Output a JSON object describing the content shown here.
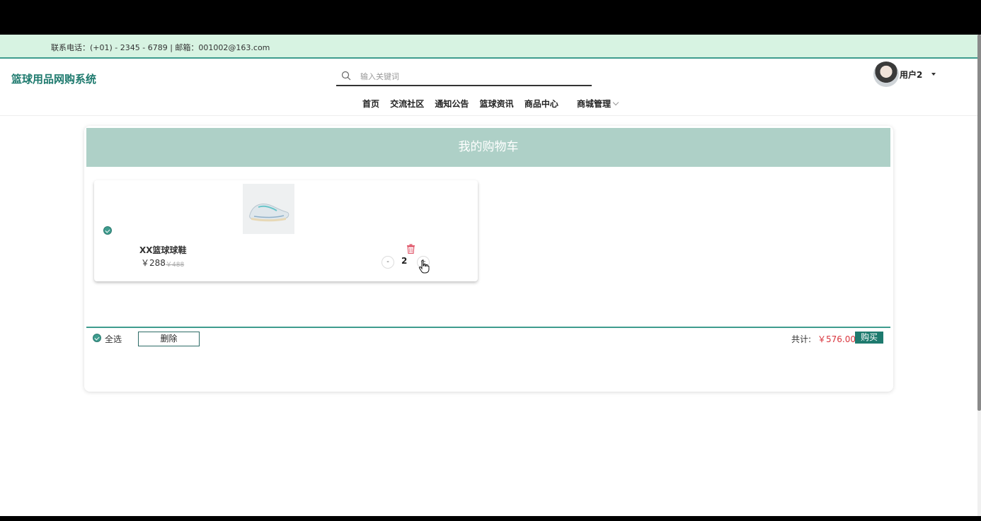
{
  "topbar": {
    "contact": "联系电话：(+01) - 2345 - 6789 | 邮箱：001002@163.com"
  },
  "header": {
    "logo": "篮球用品网购系统",
    "search_placeholder": "输入关键词",
    "user_name": "用户2"
  },
  "nav": {
    "items": [
      "首页",
      "交流社区",
      "通知公告",
      "篮球资讯",
      "商品中心",
      "商城管理"
    ]
  },
  "cart": {
    "title": "我的购物车",
    "item": {
      "name": "XX篮球球鞋",
      "price": "￥288",
      "old_price": "￥488",
      "quantity": "2",
      "minus": "-",
      "plus": "+"
    },
    "select_all": "全选",
    "delete_label": "删除",
    "total_label": "共计:",
    "total_value": "￥576.00",
    "buy_label": "购买"
  },
  "colors": {
    "accent": "#1e7a6e",
    "title_bg": "#aed0c7",
    "topbar_bg": "#d7f3e2",
    "total": "#d9363e"
  },
  "icons": [
    "search-icon",
    "trash-icon",
    "caret-down-icon",
    "chevron-down-icon",
    "check-icon",
    "hand-cursor-icon"
  ]
}
